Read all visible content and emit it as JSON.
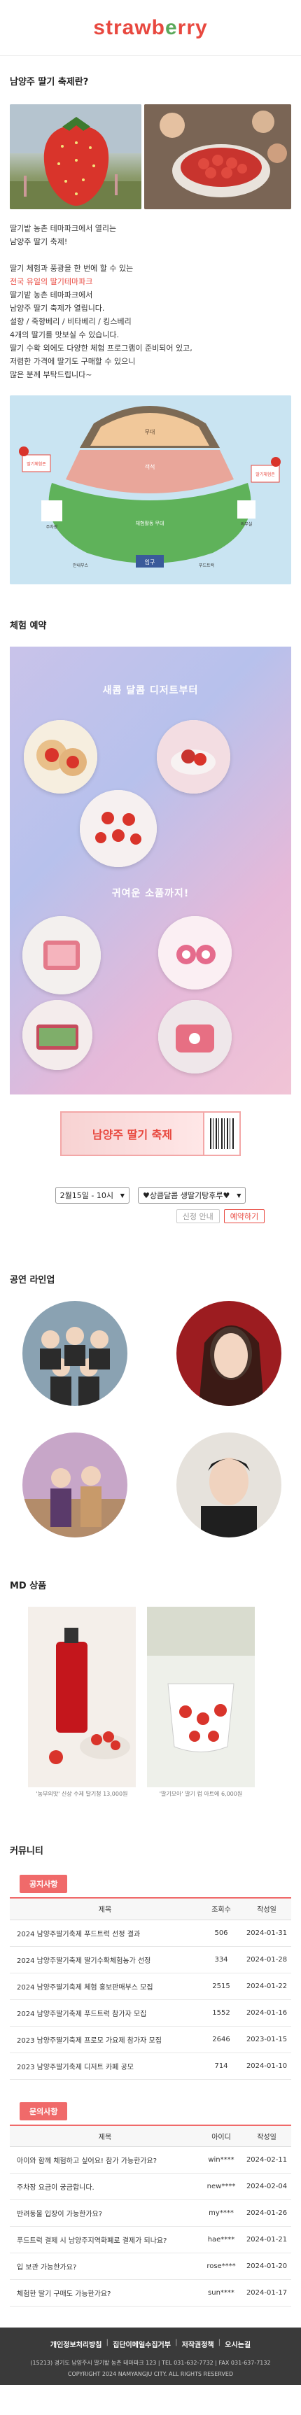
{
  "header": {
    "logo_part1": "strawb",
    "logo_part2": "e",
    "logo_part3": "rry"
  },
  "intro": {
    "title": "남양주 딸기 축제란?",
    "lines": [
      "딸기밭 농촌 테마파크에서 열리는",
      "남양주 딸기 축제!",
      "",
      "딸기 체험과 풍광을 한 번에 할 수 있는",
      "전국 유일의 딸기테마파크",
      "딸기밭 농촌 테마파크에서",
      "남양주 딸기 축제가 열립니다.",
      "설향 / 죽향베리 / 비타베리 / 킹스베리",
      "4개의 딸기를 맛보실 수 있습니다.",
      "딸기 수확 외에도 다양한 체험 프로그램이 준비되어 있고,",
      "저렴한 가격에 딸기도 구매할 수 있으니",
      "많은 분께 부탁드립니다~"
    ],
    "red_line_index": 4
  },
  "map": {
    "labels": {
      "stage": "무대",
      "seat": "객석",
      "field": "체험활동 무대",
      "entrance": "입구",
      "booth1": "딸기체험존",
      "booth2": "딸기체험존",
      "booth3": "주차장",
      "booth4": "의무실",
      "info": "안내부스",
      "food": "푸드트럭",
      "toilet": "화장실"
    }
  },
  "reservation": {
    "title": "체험 예약",
    "poster_heading1": "새콤 달콤 디저트부터",
    "poster_heading2": "귀여운 소품까지!",
    "ticket_text": "남양주 딸기 축제",
    "date_select": "2월15일 - 10시",
    "program_select": "♥상큼달콤 생딸기탕후루♥",
    "btn_check": "신청 안내",
    "btn_reserve": "예약하기"
  },
  "lineup": {
    "title": "공연 라인업"
  },
  "md": {
    "title": "MD 상품",
    "items": [
      {
        "caption": "'농부의맛' 신상 수제 딸기청 13,000원"
      },
      {
        "caption": "'딸기모아' 딸기 컵 아트에 6,000원"
      }
    ]
  },
  "community": {
    "title": "커뮤니티",
    "notice": {
      "tag": "공지사항",
      "headers": [
        "제목",
        "조회수",
        "작성일"
      ],
      "rows": [
        [
          "2024 남양주딸기축제 푸드트럭 선정 결과",
          "506",
          "2024-01-31"
        ],
        [
          "2024 남양주딸기축제 딸기수확체험농가 선정",
          "334",
          "2024-01-28"
        ],
        [
          "2024 남양주딸기축제 체험 홍보판매부스 모집",
          "2515",
          "2024-01-22"
        ],
        [
          "2024 남양주딸기축제 푸드트럭 참가자 모집",
          "1552",
          "2024-01-16"
        ],
        [
          "2023 남양주딸기축제 프로모 가요제 참가자 모집",
          "2646",
          "2023-01-15"
        ],
        [
          "2023 남양주딸기축제 디저트 카페 공모",
          "714",
          "2024-01-10"
        ]
      ]
    },
    "qna": {
      "tag": "문의사항",
      "headers": [
        "제목",
        "아이디",
        "작성일"
      ],
      "rows": [
        [
          "아이와 함께 체험하고 싶어요! 참가 가능한가요?",
          "win****",
          "2024-02-11"
        ],
        [
          "주차장 요금이 궁금합니다.",
          "new****",
          "2024-02-04"
        ],
        [
          "반려동물 입장이 가능한가요?",
          "my****",
          "2024-01-26"
        ],
        [
          "푸드트럭 결제 시 남양주지역화폐로 결제가 되나요?",
          "hae****",
          "2024-01-21"
        ],
        [
          "입 보관 가능한가요?",
          "rose****",
          "2024-01-20"
        ],
        [
          "체험한 딸기 구매도 가능한가요?",
          "sun****",
          "2024-01-17"
        ]
      ]
    }
  },
  "footer": {
    "links": [
      "개인정보처리방침",
      "집단이메일수집거부",
      "저작권정책",
      "오시는길"
    ],
    "address": "(15213) 경기도 남양주시 딸기밭 농촌 테마파크 123 | TEL 031-632-7732 | FAX 031-637-7132",
    "copyright": "COPYRIGHT 2024 NAMYANGJU CITY. ALL RIGHTS RESERVED"
  },
  "colors": {
    "accent": "#e8483f",
    "green": "#5aa85a",
    "tag": "#f06a6a"
  }
}
